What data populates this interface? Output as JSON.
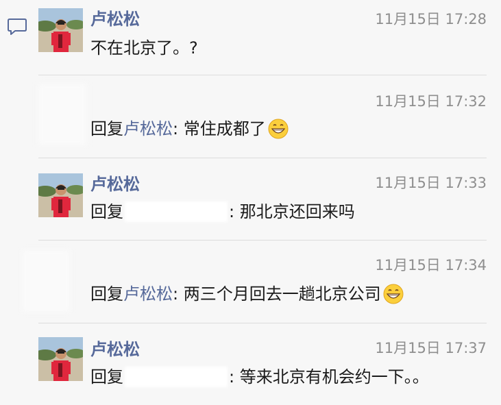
{
  "comments": [
    {
      "name": "卢松松",
      "time": "11月15日 17:28",
      "text": "不在北京了。?"
    },
    {
      "time": "11月15日 17:32",
      "reply_label": "回复",
      "mention": "卢松松",
      "text": ": 常住成都了",
      "emoji": "grin-emoji"
    },
    {
      "name": "卢松松",
      "time": "11月15日 17:33",
      "reply_label": "回复",
      "text": ": 那北京还回来吗"
    },
    {
      "time": "11月15日 17:34",
      "reply_label": "回复",
      "mention": "卢松松",
      "text": ": 两三个月回去一趟北京公司",
      "emoji": "grin-emoji"
    },
    {
      "name": "卢松松",
      "time": "11月15日 17:37",
      "reply_label": "回复",
      "text": ": 等来北京有机会约一下。。"
    }
  ],
  "colors": {
    "name": "#56699a",
    "time": "#8e8e8e",
    "background": "#f7f7f7"
  }
}
